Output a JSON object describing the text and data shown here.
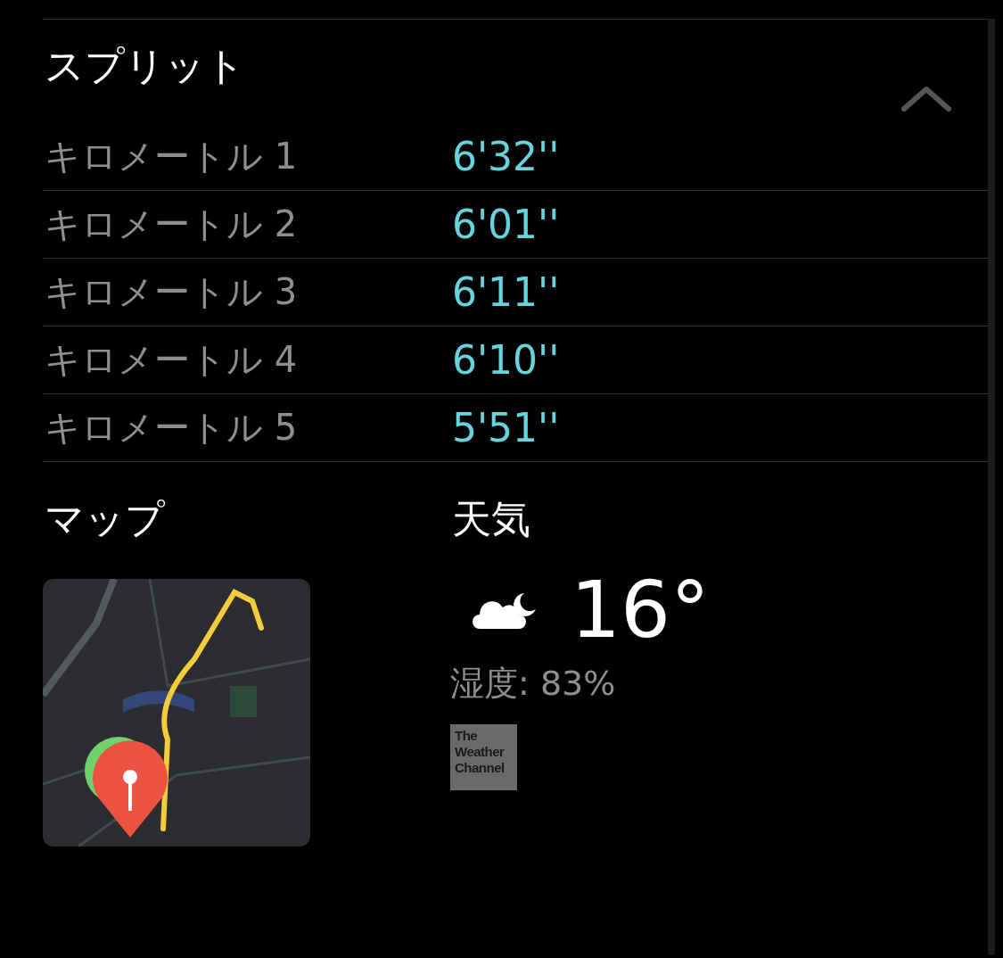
{
  "splits": {
    "title": "スプリット",
    "expanded": true,
    "rows": [
      {
        "label": "キロメートル 1",
        "pace": "6'32''"
      },
      {
        "label": "キロメートル 2",
        "pace": "6'01''"
      },
      {
        "label": "キロメートル 3",
        "pace": "6'11''"
      },
      {
        "label": "キロメートル 4",
        "pace": "6'10''"
      },
      {
        "label": "キロメートル 5",
        "pace": "5'51''"
      }
    ]
  },
  "map": {
    "title": "マップ",
    "kind": "picture"
  },
  "weather": {
    "title": "天気",
    "temperature": "16°",
    "humidity": "湿度: 83%",
    "provider_logo": "The Weather Channel"
  }
}
